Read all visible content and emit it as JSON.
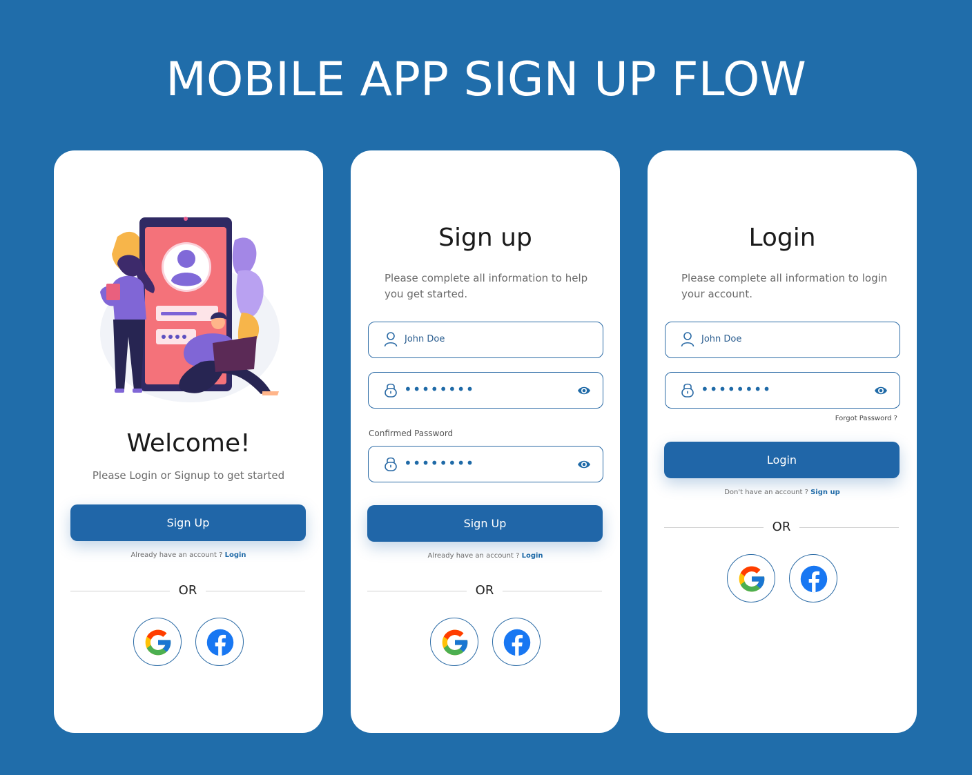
{
  "page": {
    "heading": "MOBILE APP SIGN UP FLOW"
  },
  "colors": {
    "background": "#206daa",
    "primary": "#2066a8",
    "card": "#ffffff"
  },
  "welcome": {
    "title": "Welcome!",
    "subtitle": "Please Login or Signup to get started",
    "signup_button": "Sign Up",
    "account_prompt": "Already have an account ?",
    "login_link": "Login",
    "or_text": "OR",
    "social": [
      "google-icon",
      "facebook-icon"
    ]
  },
  "signup": {
    "title": "Sign up",
    "subtitle": "Please complete all information to help you get started.",
    "name_value": "John Doe",
    "password_value": "••••••••",
    "confirm_label": "Confirmed Password",
    "confirm_value": "••••••••",
    "signup_button": "Sign Up",
    "account_prompt": "Already have an account ?",
    "login_link": "Login",
    "or_text": "OR"
  },
  "login": {
    "title": "Login",
    "subtitle": "Please complete all information to login your account.",
    "name_value": "John Doe",
    "password_value": "••••••••",
    "forgot": "Forgot Password ?",
    "login_button": "Login",
    "account_prompt": "Don't have an account ?",
    "signup_link": "Sign up",
    "or_text": "OR"
  }
}
